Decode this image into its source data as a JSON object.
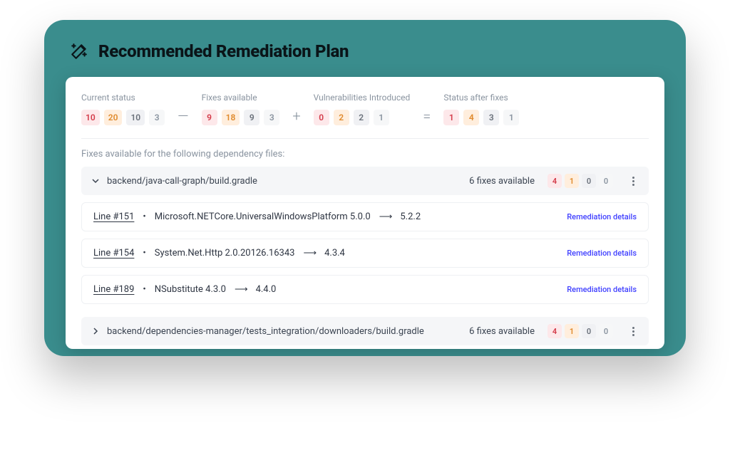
{
  "header": {
    "title": "Recommended Remediation Plan"
  },
  "summary": {
    "blocks": [
      {
        "label": "Current status",
        "chips": [
          {
            "v": "10",
            "sev": "critical"
          },
          {
            "v": "20",
            "sev": "high"
          },
          {
            "v": "10",
            "sev": "medium"
          },
          {
            "v": "3",
            "sev": "low"
          }
        ]
      },
      {
        "label": "Fixes available",
        "chips": [
          {
            "v": "9",
            "sev": "critical"
          },
          {
            "v": "18",
            "sev": "high"
          },
          {
            "v": "9",
            "sev": "medium"
          },
          {
            "v": "3",
            "sev": "low"
          }
        ]
      },
      {
        "label": "Vulnerabilities Introduced",
        "chips": [
          {
            "v": "0",
            "sev": "critical"
          },
          {
            "v": "2",
            "sev": "high"
          },
          {
            "v": "2",
            "sev": "medium"
          },
          {
            "v": "1",
            "sev": "low"
          }
        ]
      },
      {
        "label": "Status after fixes",
        "chips": [
          {
            "v": "1",
            "sev": "critical"
          },
          {
            "v": "4",
            "sev": "high"
          },
          {
            "v": "3",
            "sev": "medium"
          },
          {
            "v": "1",
            "sev": "low"
          }
        ]
      }
    ],
    "ops": [
      "—",
      "+",
      "="
    ]
  },
  "section_caption": "Fixes available for the following dependency files:",
  "groups": [
    {
      "expanded": true,
      "path": "backend/java-call-graph/build.gradle",
      "fixes_label": "6 fixes available",
      "chips": [
        {
          "v": "4",
          "sev": "critical"
        },
        {
          "v": "1",
          "sev": "high"
        },
        {
          "v": "0",
          "sev": "medium"
        },
        {
          "v": "0",
          "sev": "low"
        }
      ],
      "rows": [
        {
          "line": "Line #151",
          "pkg": "Microsoft.NETCore.UniversalWindowsPlatform 5.0.0",
          "to": "5.2.2",
          "details": "Remediation details"
        },
        {
          "line": "Line #154",
          "pkg": "System.Net.Http 2.0.20126.16343",
          "to": "4.3.4",
          "details": "Remediation details"
        },
        {
          "line": "Line #189",
          "pkg": "NSubstitute 4.3.0",
          "to": "4.4.0",
          "details": "Remediation details"
        }
      ]
    },
    {
      "expanded": false,
      "path": "backend/dependencies-manager/tests_integration/downloaders/build.gradle",
      "fixes_label": "6 fixes available",
      "chips": [
        {
          "v": "4",
          "sev": "critical"
        },
        {
          "v": "1",
          "sev": "high"
        },
        {
          "v": "0",
          "sev": "medium"
        },
        {
          "v": "0",
          "sev": "low"
        }
      ],
      "rows": []
    }
  ]
}
